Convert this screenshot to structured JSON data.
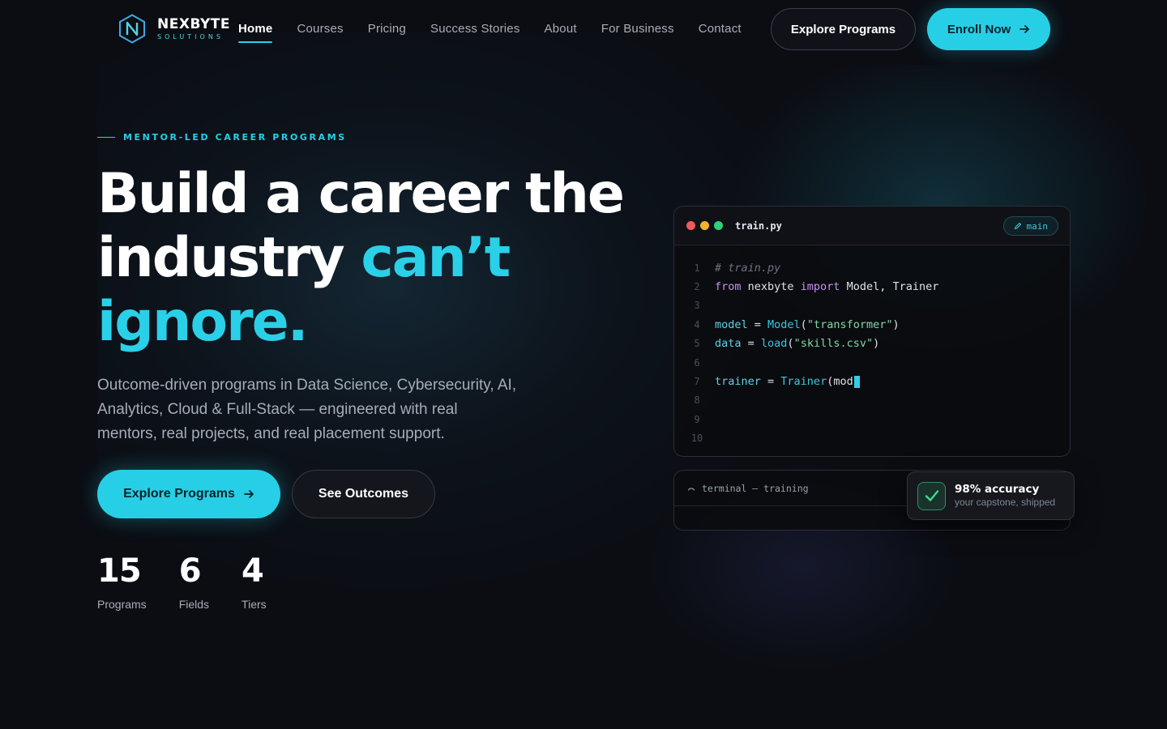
{
  "brand": {
    "name": "NEXBYTE",
    "tagline": "SOLUTIONS"
  },
  "nav": {
    "links": [
      "Home",
      "Courses",
      "Pricing",
      "Success Stories",
      "About",
      "For Business",
      "Contact"
    ],
    "active": "Home",
    "explore_label": "Explore Programs",
    "enroll_label": "Enroll Now"
  },
  "hero": {
    "eyebrow": "MENTOR-LED CAREER PROGRAMS",
    "headline_line1": "Build a career the",
    "headline_line2_plain": "industry ",
    "headline_line2_accent": "can’t",
    "headline_line3_accent": "ignore.",
    "lede": "Outcome-driven programs in Data Science, Cybersecurity, AI, Analytics, Cloud & Full-Stack — engineered with real mentors, real projects, and real placement support.",
    "primary_cta": "Explore Programs",
    "secondary_cta": "See Outcomes",
    "stats": [
      {
        "value": "15",
        "label": "Programs"
      },
      {
        "value": "6",
        "label": "Fields"
      },
      {
        "value": "4",
        "label": "Tiers"
      }
    ]
  },
  "code_window": {
    "filename": "train.py",
    "branch": "main",
    "line_numbers": [
      "1",
      "2",
      "3",
      "4",
      "5",
      "6",
      "7",
      "8",
      "9",
      "10"
    ],
    "lines": {
      "l1_comment": "# train.py",
      "l2_from": "from",
      "l2_module": " nexbyte ",
      "l2_import": "import",
      "l2_names": " Model, Trainer",
      "l4_var": "model",
      "l4_eq": " = ",
      "l4_fn": "Model",
      "l4_open": "(",
      "l4_str": "\"transformer\"",
      "l4_close": ")",
      "l5_var": "data",
      "l5_eq": " = ",
      "l5_fn": "load",
      "l5_open": "(",
      "l5_str": "\"skills.csv\"",
      "l5_close": ")",
      "l7_var": "trainer",
      "l7_eq": " = ",
      "l7_fn": "Trainer",
      "l7_rest": "(mod"
    }
  },
  "terminal": {
    "title": "terminal — training"
  },
  "badge": {
    "title": "98% accuracy",
    "subtitle": "your capstone, shipped"
  },
  "colors": {
    "accent": "#27cfe6",
    "background": "#0b0d13",
    "success": "#2fcf7b"
  }
}
